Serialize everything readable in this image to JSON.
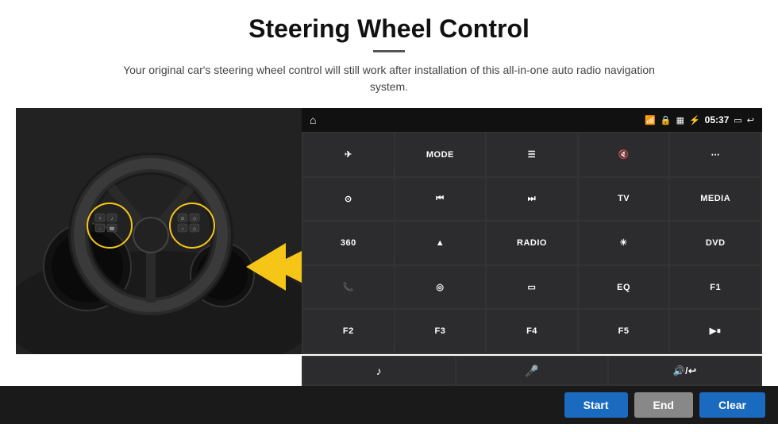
{
  "page": {
    "title": "Steering Wheel Control",
    "subtitle": "Your original car's steering wheel control will still work after installation of this all-in-one auto radio navigation system."
  },
  "status_bar": {
    "home_icon": "⌂",
    "wifi_icon": "WiFi",
    "lock_icon": "🔒",
    "sd_icon": "SD",
    "bt_icon": "BT",
    "time": "05:37",
    "screen_icon": "▭",
    "back_icon": "↩"
  },
  "grid_buttons": [
    {
      "label": "✈",
      "row": 1,
      "col": 1
    },
    {
      "label": "MODE",
      "row": 1,
      "col": 2
    },
    {
      "label": "☰",
      "row": 1,
      "col": 3
    },
    {
      "label": "🔇",
      "row": 1,
      "col": 4
    },
    {
      "label": "⋯",
      "row": 1,
      "col": 5
    },
    {
      "label": "⊙",
      "row": 2,
      "col": 1
    },
    {
      "label": "⏮",
      "row": 2,
      "col": 2
    },
    {
      "label": "⏭",
      "row": 2,
      "col": 3
    },
    {
      "label": "TV",
      "row": 2,
      "col": 4
    },
    {
      "label": "MEDIA",
      "row": 2,
      "col": 5
    },
    {
      "label": "360",
      "row": 3,
      "col": 1
    },
    {
      "label": "▲",
      "row": 3,
      "col": 2
    },
    {
      "label": "RADIO",
      "row": 3,
      "col": 3
    },
    {
      "label": "☀",
      "row": 3,
      "col": 4
    },
    {
      "label": "DVD",
      "row": 3,
      "col": 5
    },
    {
      "label": "📞",
      "row": 4,
      "col": 1
    },
    {
      "label": "◎",
      "row": 4,
      "col": 2
    },
    {
      "label": "▭",
      "row": 4,
      "col": 3
    },
    {
      "label": "EQ",
      "row": 4,
      "col": 4
    },
    {
      "label": "F1",
      "row": 4,
      "col": 5
    },
    {
      "label": "F2",
      "row": 5,
      "col": 1
    },
    {
      "label": "F3",
      "row": 5,
      "col": 2
    },
    {
      "label": "F4",
      "row": 5,
      "col": 3
    },
    {
      "label": "F5",
      "row": 5,
      "col": 4
    },
    {
      "label": "▶⏸",
      "row": 5,
      "col": 5
    }
  ],
  "extra_row": [
    {
      "label": "♪"
    },
    {
      "label": "🎤"
    },
    {
      "label": "🔊/↩"
    }
  ],
  "bottom_buttons": {
    "start": "Start",
    "end": "End",
    "clear": "Clear"
  }
}
